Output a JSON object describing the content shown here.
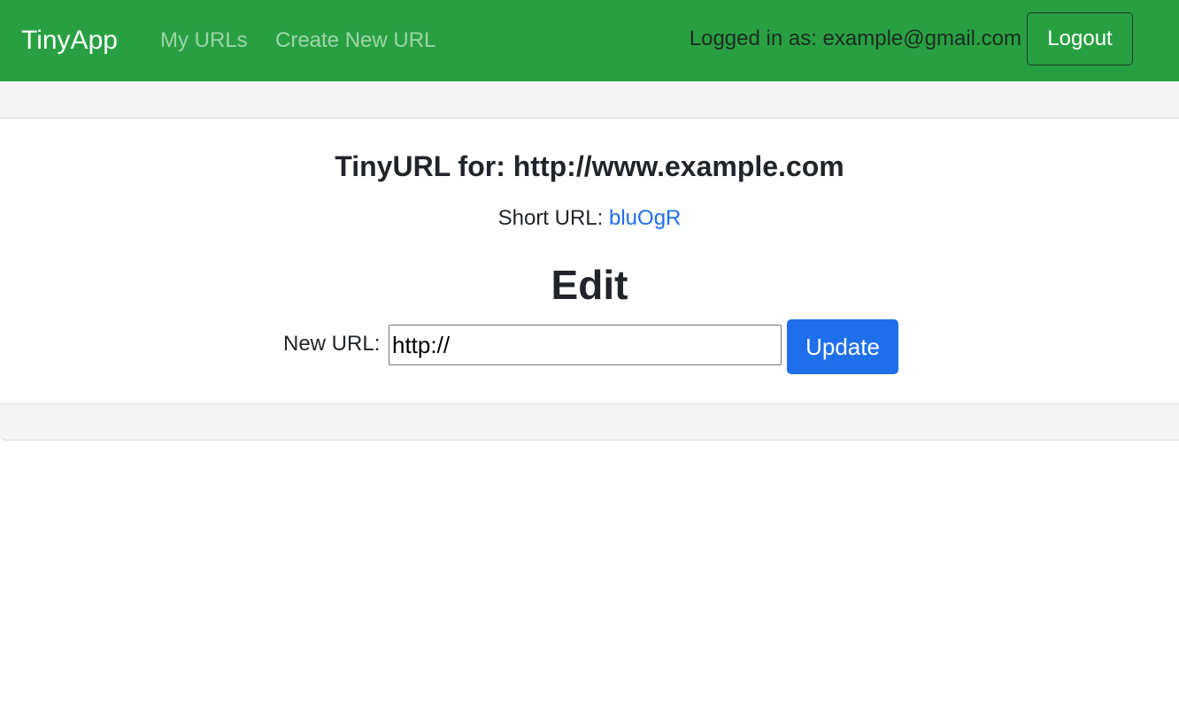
{
  "navbar": {
    "brand": "TinyApp",
    "links": [
      {
        "label": "My URLs"
      },
      {
        "label": "Create New URL"
      }
    ],
    "logged_in_text": "Logged in as: example@gmail.com",
    "logout_label": "Logout",
    "color": "#28a042"
  },
  "card": {
    "title": "TinyURL for: http://www.example.com",
    "short_url_label": "Short URL: ",
    "short_url_value": "bluOgR",
    "edit_heading": "Edit",
    "form": {
      "label": "New URL:",
      "input_value": "http://",
      "submit_label": "Update"
    }
  },
  "colors": {
    "link": "#1f6feb",
    "button_primary": "#1f6feb",
    "card_cap": "#f5f5f5"
  }
}
